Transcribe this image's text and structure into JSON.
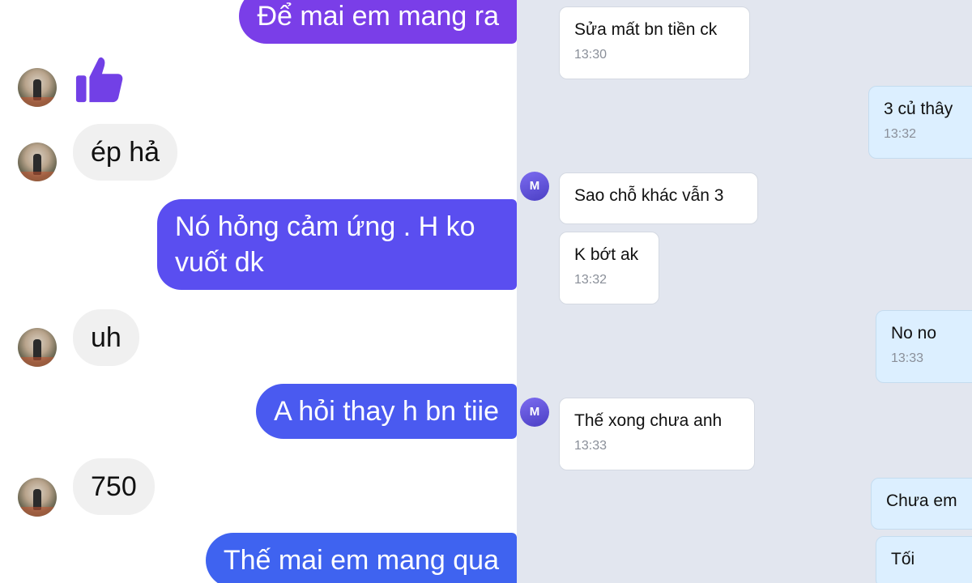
{
  "messenger": {
    "messages": [
      {
        "text": "Để mai em mang ra"
      },
      {
        "text": "ép hả"
      },
      {
        "text": "Nó hỏng cảm ứng . H ko vuốt dk"
      },
      {
        "text": "uh"
      },
      {
        "text": "A hỏi thay h bn tiie"
      },
      {
        "text": "750"
      },
      {
        "text": "Thế mai em mang qua"
      }
    ],
    "like_icon": "thumbs-up-icon",
    "colors": {
      "outgoing_top": "#7a3ee8",
      "outgoing_mid": "#5a4ef0",
      "outgoing_bottom": "#3f63f0",
      "incoming": "#f0f0f0"
    }
  },
  "zalo": {
    "contact_initial": "M",
    "messages": [
      {
        "text": "Sửa mất bn tiền ck",
        "time": "13:30"
      },
      {
        "text": "3 củ thây",
        "time": "13:32"
      },
      {
        "text": "Sao chỗ khác vẫn 3"
      },
      {
        "text": "K bớt ak",
        "time": "13:32"
      },
      {
        "text": "No no",
        "time": "13:33"
      },
      {
        "text": "Thế xong chưa anh",
        "time": "13:33"
      },
      {
        "text": "Chưa em"
      },
      {
        "text": "Tối"
      }
    ]
  }
}
